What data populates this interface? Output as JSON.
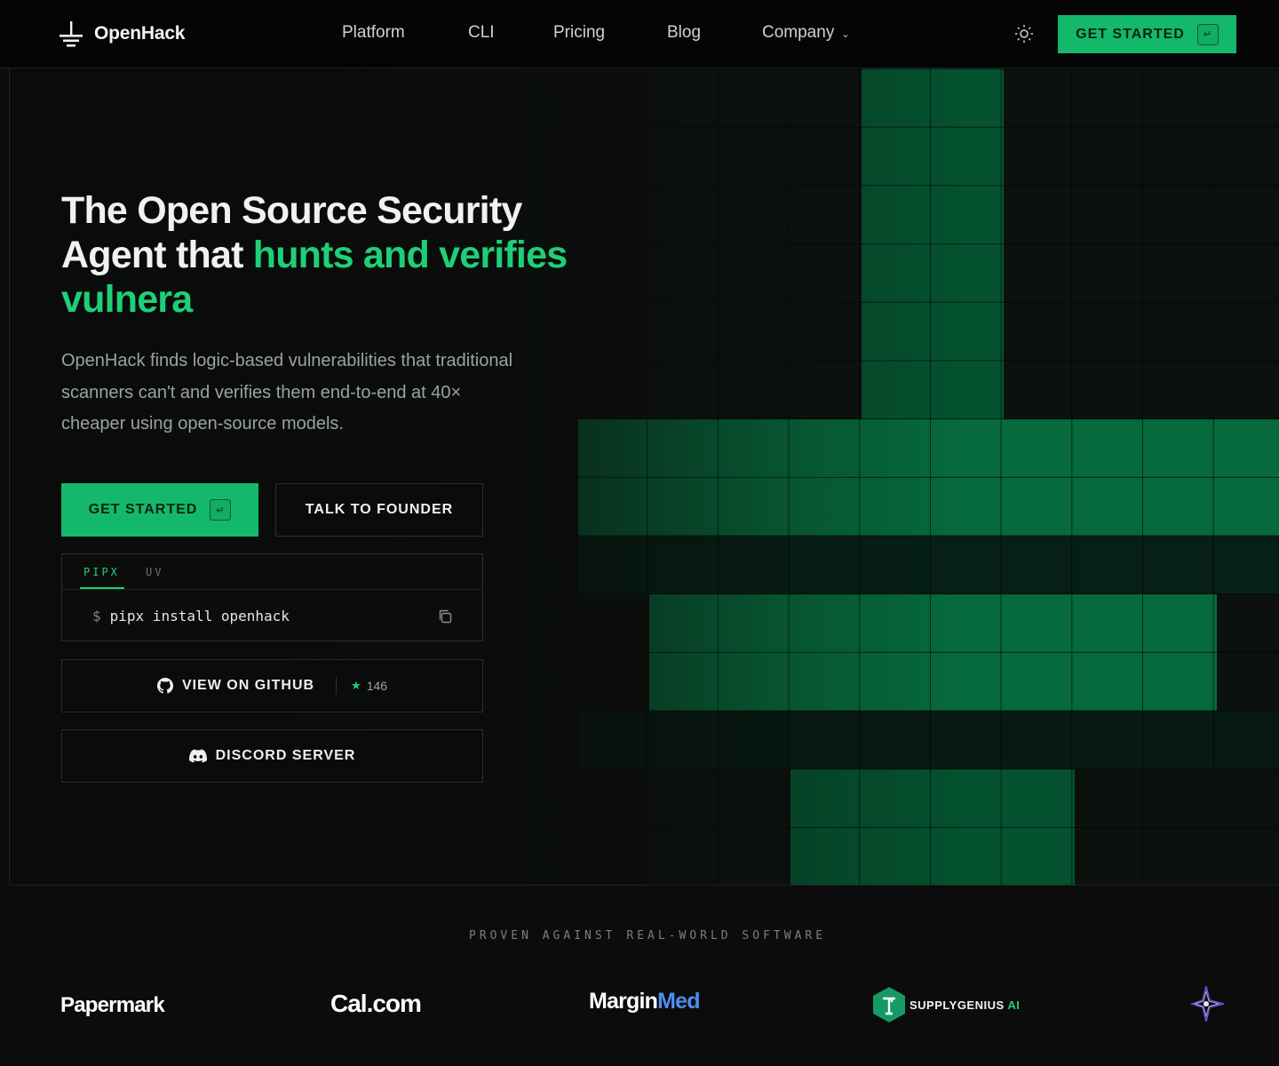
{
  "nav": {
    "brand": "OpenHack",
    "links": [
      {
        "label": "Platform"
      },
      {
        "label": "CLI"
      },
      {
        "label": "Pricing"
      },
      {
        "label": "Blog"
      },
      {
        "label": "Company",
        "caret": "⌄"
      }
    ],
    "cta_label": "GET STARTED",
    "cta_key": "↵"
  },
  "hero": {
    "headline_part1": "The Open Source Security Agent that ",
    "headline_accent": "hunts and verifies vulnera",
    "subtitle": "OpenHack finds logic-based vulnerabilities that traditional scanners can't and verifies them end-to-end at 40× cheaper using open-source models.",
    "primary_label": "GET STARTED",
    "primary_key": "↵",
    "secondary_label": "TALK TO FOUNDER",
    "install": {
      "tabs": [
        "PIPX",
        "UV"
      ],
      "active_tab": "PIPX",
      "prompt": "$",
      "command": "pipx install openhack"
    },
    "github_label": "VIEW ON GITHUB",
    "github_stars": "146",
    "discord_label": "DISCORD SERVER"
  },
  "proven": {
    "heading": "PROVEN AGAINST REAL-WORLD SOFTWARE",
    "logos": {
      "papermark": "Papermark",
      "calcom": "Cal.com",
      "margin": "Margin",
      "med": "Med",
      "supply": "SUPPLYGENIUS",
      "supply_ai": "AI"
    }
  },
  "colors": {
    "accent": "#14b86a",
    "accent_text": "#1fcf77",
    "background": "#0b0c0b"
  }
}
